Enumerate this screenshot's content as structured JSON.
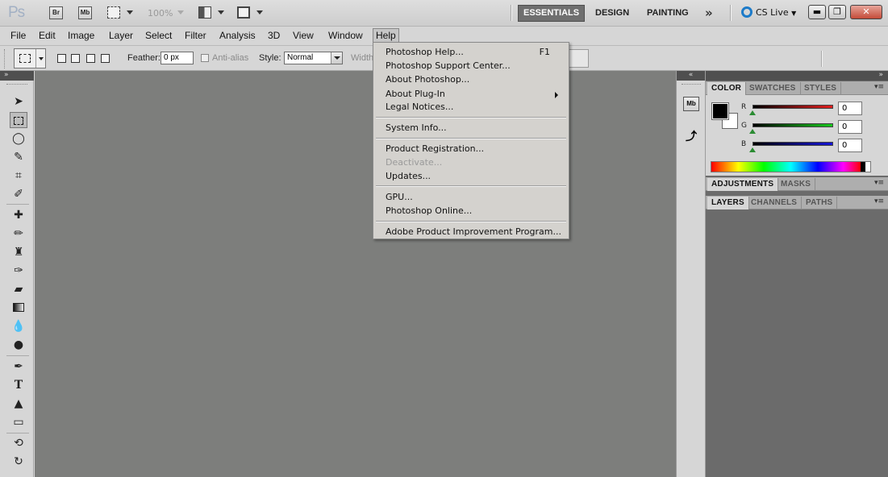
{
  "app": {
    "logo": "Ps",
    "bridge_label": "Br",
    "minibridge_label": "Mb",
    "zoom": "100%"
  },
  "workspaces": {
    "essentials": "ESSENTIALS",
    "design": "DESIGN",
    "painting": "PAINTING",
    "more": "»"
  },
  "cs_live": "CS Live",
  "window_controls": {
    "minimize": "▬",
    "restore": "❐",
    "close": "✕"
  },
  "menu": [
    "File",
    "Edit",
    "Image",
    "Layer",
    "Select",
    "Filter",
    "Analysis",
    "3D",
    "View",
    "Window",
    "Help"
  ],
  "options": {
    "feather_label": "Feather:",
    "feather_value": "0 px",
    "antialias_label": "Anti-alias",
    "style_label": "Style:",
    "style_value": "Normal",
    "width_label": "Width"
  },
  "help_menu": {
    "items": [
      {
        "label": "Photoshop Help...",
        "shortcut": "F1"
      },
      {
        "label": "Photoshop Support Center..."
      },
      {
        "label": "About Photoshop..."
      },
      {
        "label": "About Plug-In"
      },
      {
        "label": "Legal Notices..."
      },
      {
        "label": "System Info..."
      },
      {
        "label": "Product Registration..."
      },
      {
        "label": "Deactivate...",
        "disabled": true
      },
      {
        "label": "Updates..."
      },
      {
        "label": "GPU..."
      },
      {
        "label": "Photoshop Online..."
      },
      {
        "label": "Adobe Product Improvement Program..."
      }
    ]
  },
  "panels": {
    "color_tabs": [
      "COLOR",
      "SWATCHES",
      "STYLES"
    ],
    "adjust_tabs": [
      "ADJUSTMENTS",
      "MASKS"
    ],
    "layer_tabs": [
      "LAYERS",
      "CHANNELS",
      "PATHS"
    ],
    "channels": [
      {
        "label": "R",
        "value": "0",
        "color": "#e31d1d"
      },
      {
        "label": "G",
        "value": "0",
        "color": "#17c81c"
      },
      {
        "label": "B",
        "value": "0",
        "color": "#1515d8"
      }
    ],
    "collapse_glyph": "»",
    "expand_glyph": "«",
    "menu_glyph": "▾≡"
  },
  "colors": {
    "canvas": "#7d7e7c",
    "panel_bg": "#d6d6d6",
    "foreground": "#000000",
    "background": "#ffffff"
  }
}
